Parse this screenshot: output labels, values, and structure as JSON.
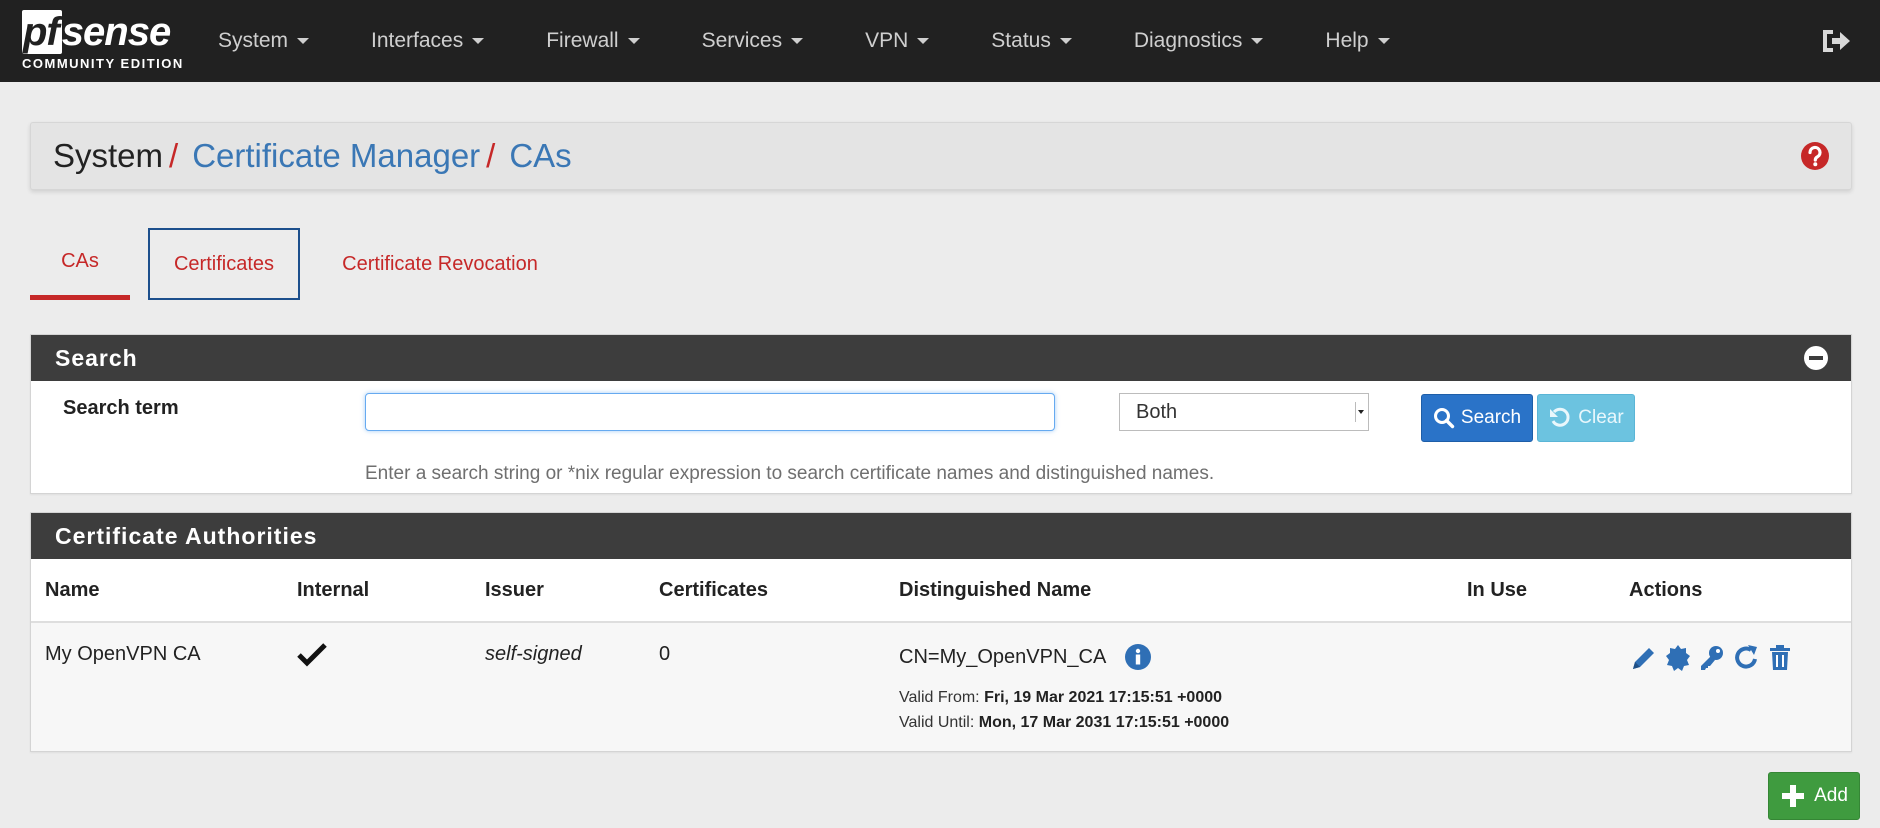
{
  "brand": {
    "logo_main": "pfsense",
    "logo_pf": "pf",
    "logo_rest": "sense",
    "logo_sub": "COMMUNITY EDITION"
  },
  "nav": {
    "items": [
      {
        "label": "System"
      },
      {
        "label": "Interfaces"
      },
      {
        "label": "Firewall"
      },
      {
        "label": "Services"
      },
      {
        "label": "VPN"
      },
      {
        "label": "Status"
      },
      {
        "label": "Diagnostics"
      },
      {
        "label": "Help"
      }
    ],
    "logout_icon": "sign-out-icon"
  },
  "breadcrumb": {
    "root": "System",
    "sep": "/",
    "items": [
      "Certificate Manager",
      "CAs"
    ],
    "help_icon": "question-circle-icon"
  },
  "tabs": [
    {
      "label": "CAs",
      "active": true
    },
    {
      "label": "Certificates",
      "focused": true
    },
    {
      "label": "Certificate Revocation"
    }
  ],
  "search": {
    "title": "Search",
    "label": "Search term",
    "input_value": "",
    "placeholder": "",
    "select_value": "Both",
    "search_btn": "Search",
    "clear_btn": "Clear",
    "hint": "Enter a search string or *nix regular expression to search certificate names and distinguished names."
  },
  "ca_table": {
    "title": "Certificate Authorities",
    "columns": [
      "Name",
      "Internal",
      "Issuer",
      "Certificates",
      "Distinguished Name",
      "In Use",
      "Actions"
    ],
    "rows": [
      {
        "name": "My OpenVPN CA",
        "internal": "✔",
        "issuer": "self-signed",
        "certificates": "0",
        "dn": "CN=My_OpenVPN_CA",
        "valid_from_label": "Valid From:",
        "valid_from": "Fri, 19 Mar 2021 17:15:51 +0000",
        "valid_until_label": "Valid Until:",
        "valid_until": "Mon, 17 Mar 2031 17:15:51 +0000",
        "in_use": "",
        "actions": [
          "pencil-icon",
          "certificate-icon",
          "key-icon",
          "refresh-icon",
          "trash-icon"
        ]
      }
    ]
  },
  "add_btn": "Add",
  "colors": {
    "navbar": "#212121",
    "accent_red": "#c62828",
    "link_blue": "#3a77b5",
    "search_btn": "#2a73c8",
    "clear_btn": "#6cc3e0",
    "add_btn": "#3f9b3f",
    "panel_head": "#3d3d3d"
  }
}
